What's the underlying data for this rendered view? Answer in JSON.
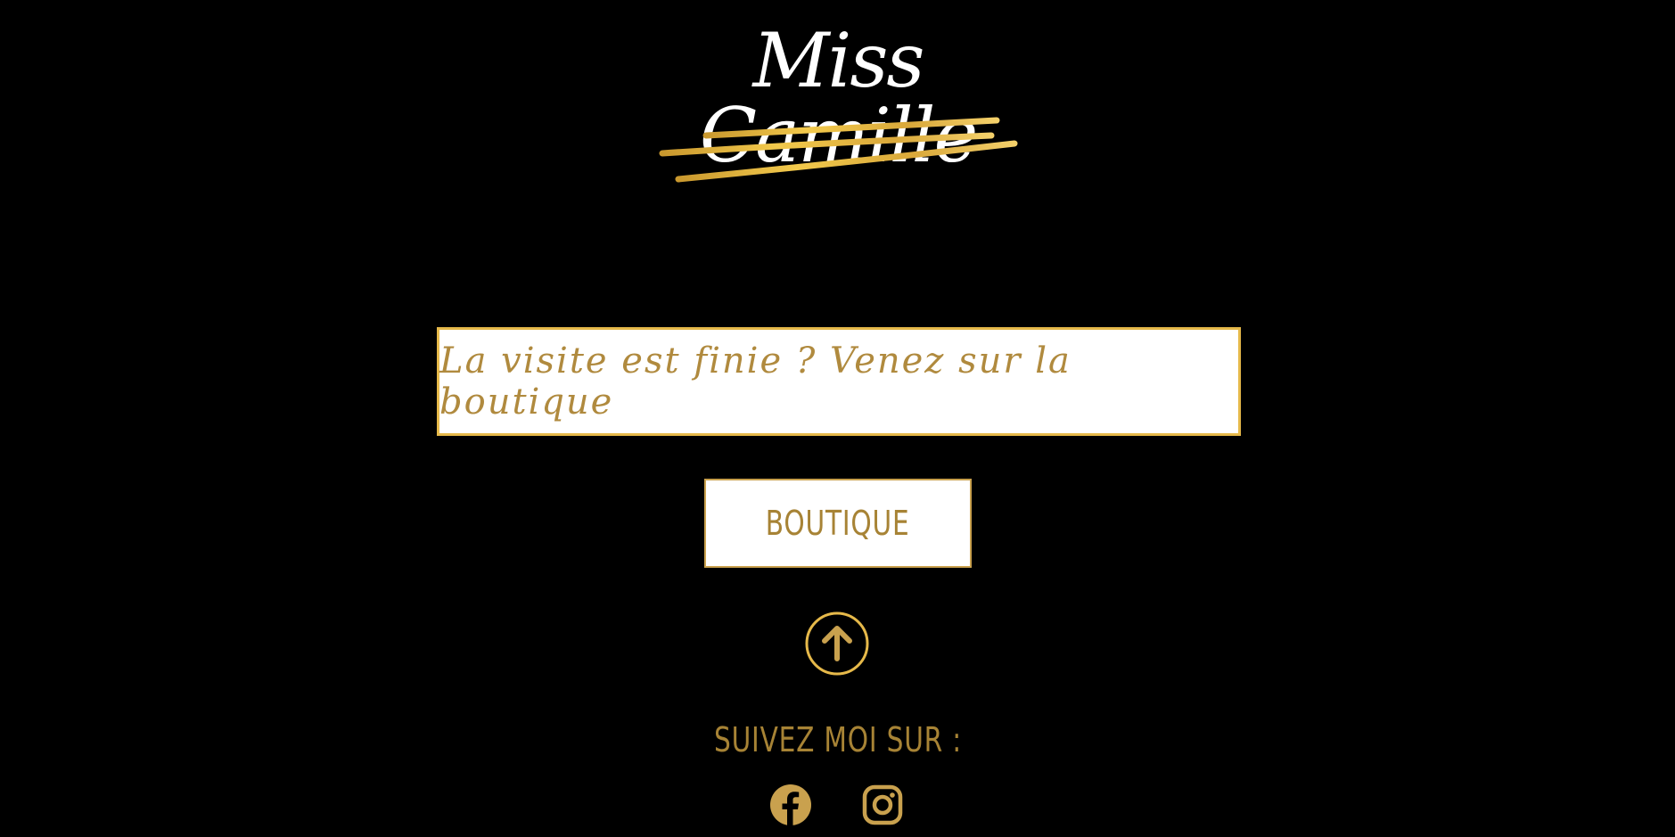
{
  "logo": {
    "text": "Miss Camille"
  },
  "banner": {
    "text": "La visite est finie ? Venez sur la boutique"
  },
  "shop_button": {
    "label": "BOUTIQUE"
  },
  "follow": {
    "label": "SUIVEZ MOI SUR :"
  },
  "icons": {
    "back_to_top": "arrow-up-circle-icon",
    "facebook": "facebook-icon",
    "instagram": "instagram-icon"
  },
  "colors": {
    "background": "#000000",
    "gold": "#c9a14e",
    "gold_text": "#a78335",
    "gold_light": "#e6b94a",
    "white": "#ffffff"
  }
}
